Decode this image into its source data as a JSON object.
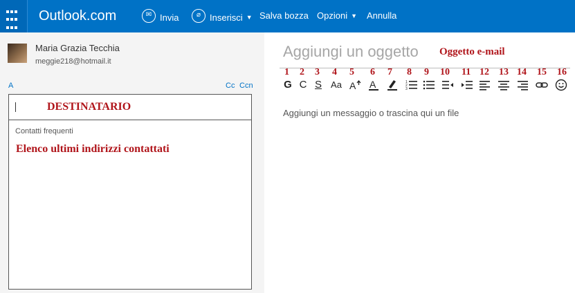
{
  "topbar": {
    "brand": "Outlook.com",
    "send_label": "Invia",
    "insert_label": "Inserisci",
    "save_draft_label": "Salva bozza",
    "options_label": "Opzioni",
    "cancel_label": "Annulla",
    "brand_color": "#0072c6"
  },
  "sender": {
    "name": "Maria Grazia Tecchia",
    "email": "meggie218@hotmail.it"
  },
  "recipients": {
    "to_label": "A",
    "cc_label": "Cc",
    "bcc_label": "Ccn",
    "to_annotation": "DESTINATARIO",
    "frequent_title": "Contatti frequenti",
    "frequent_annotation": "Elenco ultimi indirizzi contattati"
  },
  "compose": {
    "subject_placeholder": "Aggiungi un oggetto",
    "subject_annotation": "Oggetto e-mail",
    "body_placeholder": "Aggiungi un messaggio o trascina qui un file",
    "annotation_color": "#b0141a"
  },
  "toolbar": {
    "numbers": [
      "1",
      "2",
      "3",
      "4",
      "5",
      "6",
      "7",
      "8",
      "9",
      "10",
      "11",
      "12",
      "13",
      "14",
      "15",
      "16"
    ],
    "bold": "G",
    "italic": "C",
    "underline": "S",
    "font_size": "Aa",
    "icons": [
      "bold-icon",
      "italic-icon",
      "underline-icon",
      "font-size-icon",
      "grow-font-icon",
      "font-color-icon",
      "highlight-icon",
      "numbered-list-icon",
      "bullet-list-icon",
      "decrease-indent-icon",
      "increase-indent-icon",
      "align-left-icon",
      "align-center-icon",
      "align-right-icon",
      "link-icon",
      "emoji-icon"
    ]
  }
}
